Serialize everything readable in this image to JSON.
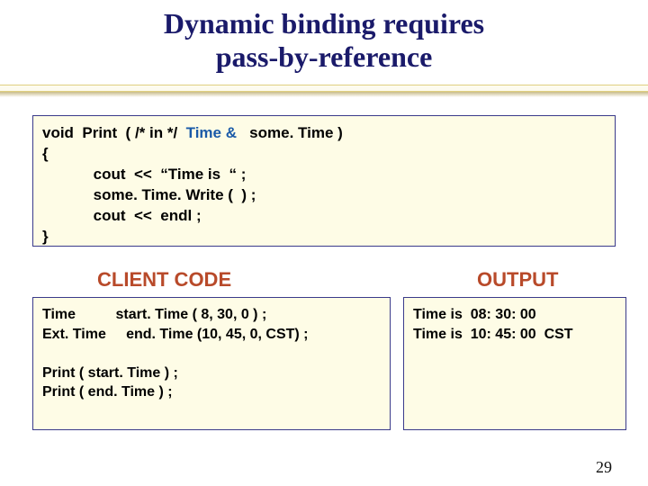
{
  "title_line1": "Dynamic binding requires",
  "title_line2": "pass-by-reference",
  "code": {
    "l1a": "void  Print  ( /* in */  ",
    "l1hl": "Time &",
    "l1b": "   some. Time )",
    "l2": "{",
    "l3": "            cout  <<  “Time is  “ ;",
    "l4": "            some. Time. Write (  ) ;",
    "l5": "            cout  <<  endl ;",
    "l6": "}"
  },
  "labels": {
    "client": "CLIENT  CODE",
    "output": "OUTPUT"
  },
  "client": {
    "l1": "Time          start. Time ( 8, 30, 0 ) ;",
    "l2": "Ext. Time     end. Time (10, 45, 0, CST) ;",
    "l3": "",
    "l4": "Print ( start. Time ) ;",
    "l5": "Print ( end. Time ) ;"
  },
  "output": {
    "l1": "Time is  08: 30: 00",
    "l2": "Time is  10: 45: 00  CST"
  },
  "page_number": "29"
}
